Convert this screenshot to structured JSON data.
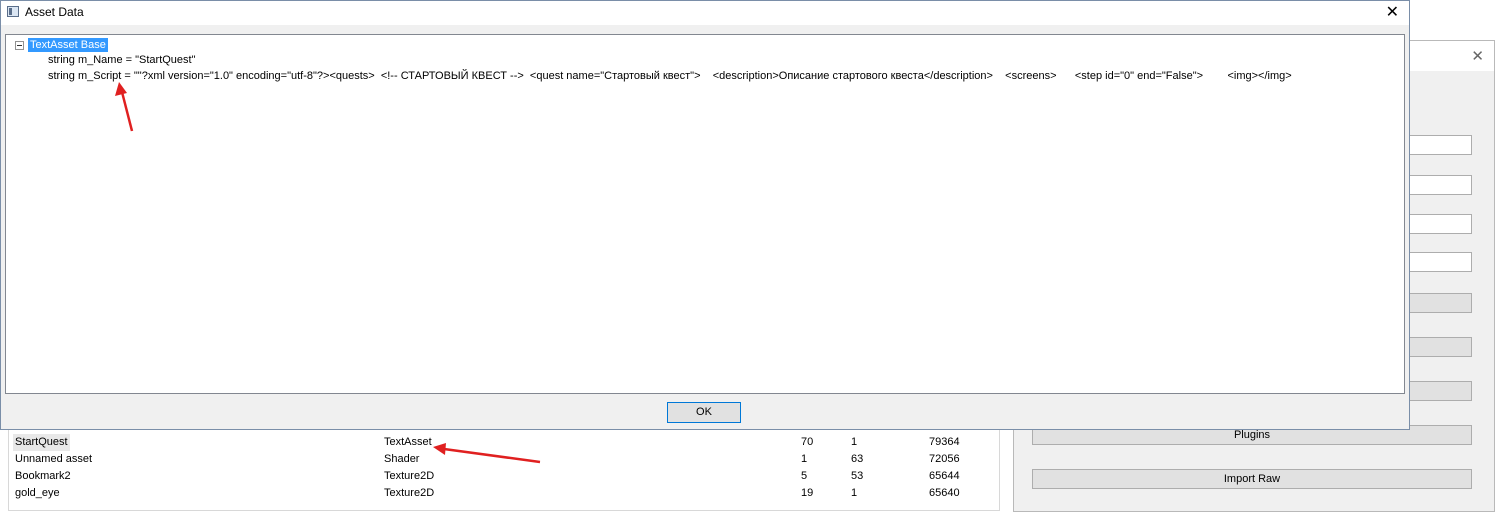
{
  "background_window": {
    "close": "✕",
    "buttons": [
      "",
      "",
      "",
      "",
      "",
      "",
      "",
      "Plugins",
      "Import Raw"
    ]
  },
  "asset_list": {
    "rows": [
      {
        "name": "StartQuest",
        "type": "TextAsset",
        "file_id": "70",
        "path_id": "1",
        "size": "79364"
      },
      {
        "name": "Unnamed asset",
        "type": "Shader",
        "file_id": "1",
        "path_id": "63",
        "size": "72056"
      },
      {
        "name": "Bookmark2",
        "type": "Texture2D",
        "file_id": "5",
        "path_id": "53",
        "size": "65644"
      },
      {
        "name": "gold_eye",
        "type": "Texture2D",
        "file_id": "19",
        "path_id": "1",
        "size": "65640"
      }
    ]
  },
  "dialog": {
    "title": "Asset Data",
    "close": "✕",
    "tree": {
      "root": "TextAsset Base",
      "children": [
        "string m_Name = \"StartQuest\"",
        "string m_Script = \"\"?xml version=\"1.0\" encoding=\"utf-8\"?><quests>  <!-- СТАРТОВЫЙ КВЕСТ -->  <quest name=\"Стартовый квест\">    <description>Описание стартового квеста</description>    <screens>      <step id=\"0\" end=\"False\">        <img></img>"
      ]
    },
    "ok_label": "OK"
  },
  "annotations": {
    "arrow_color": "#e02020"
  }
}
